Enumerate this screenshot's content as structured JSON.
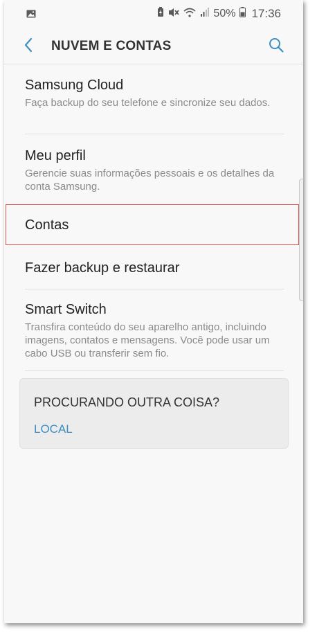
{
  "status_bar": {
    "battery_percent": "50%",
    "time": "17:36"
  },
  "header": {
    "title": "NUVEM E CONTAS"
  },
  "items": [
    {
      "title": "Samsung Cloud",
      "subtitle": "Faça backup do seu telefone e sincronize seu dados."
    },
    {
      "title": "Meu perfil",
      "subtitle": "Gerencie suas informações pessoais e os detalhes da conta Samsung."
    },
    {
      "title": "Contas"
    },
    {
      "title": "Fazer backup e restaurar"
    },
    {
      "title": "Smart Switch",
      "subtitle": "Transfira conteúdo do seu aparelho antigo, incluindo imagens, contatos e mensagens. Você pode usar um cabo USB ou transferir sem fio."
    }
  ],
  "card": {
    "title": "PROCURANDO OUTRA COISA?",
    "link": "LOCAL"
  },
  "colors": {
    "accent": "#3e8fc2",
    "highlight": "#d9534f"
  },
  "icons": {
    "back": "back-arrow-icon",
    "search": "search-icon"
  }
}
